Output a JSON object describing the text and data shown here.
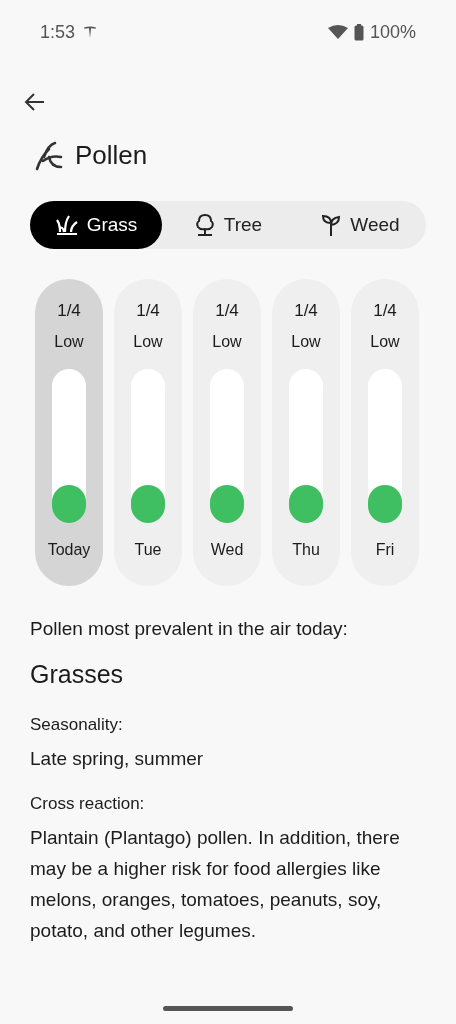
{
  "status_bar": {
    "time": "1:53",
    "battery": "100%"
  },
  "title": "Pollen",
  "tabs": [
    {
      "label": "Grass",
      "kind": "grass",
      "selected": true
    },
    {
      "label": "Tree",
      "kind": "tree",
      "selected": false
    },
    {
      "label": "Weed",
      "kind": "weed",
      "selected": false
    }
  ],
  "days": [
    {
      "index": "1/4",
      "category": "Low",
      "level": 0.25,
      "day": "Today",
      "selected": true
    },
    {
      "index": "1/4",
      "category": "Low",
      "level": 0.25,
      "day": "Tue",
      "selected": false
    },
    {
      "index": "1/4",
      "category": "Low",
      "level": 0.25,
      "day": "Wed",
      "selected": false
    },
    {
      "index": "1/4",
      "category": "Low",
      "level": 0.25,
      "day": "Thu",
      "selected": false
    },
    {
      "index": "1/4",
      "category": "Low",
      "level": 0.25,
      "day": "Fri",
      "selected": false
    }
  ],
  "heading": "Pollen most prevalent in the air today:",
  "plant": "Grasses",
  "details": [
    {
      "label": "Seasonality:",
      "value": "Late spring, summer"
    },
    {
      "label": "Cross reaction:",
      "value": "Plantain (Plantago) pollen. In addition, there may be a higher risk for food allergies like melons, oranges, tomatoes, peanuts, soy, potato, and other legumes."
    }
  ]
}
